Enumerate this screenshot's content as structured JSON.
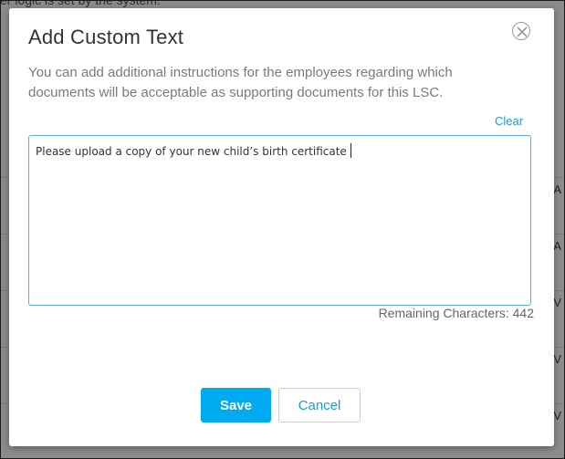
{
  "background": {
    "partial_text": "er logic is set by the system.",
    "right_letters": [
      "A",
      "A",
      "V",
      "V",
      "V"
    ]
  },
  "modal": {
    "title": "Add Custom Text",
    "description": "You can add additional instructions for the employees regarding which documents will be acceptable as supporting documents for this LSC.",
    "clear_label": "Clear",
    "textarea_value": "Please upload a copy of your new child’s birth certificate",
    "remaining_label": "Remaining Characters:",
    "remaining_count": "442",
    "save_label": "Save",
    "cancel_label": "Cancel",
    "close_icon": "close-circle-icon"
  },
  "colors": {
    "accent": "#00aaf0",
    "link": "#1a9bd7",
    "overlay": "rgba(0,0,0,0.45)",
    "textarea_border": "#5aaee6"
  }
}
